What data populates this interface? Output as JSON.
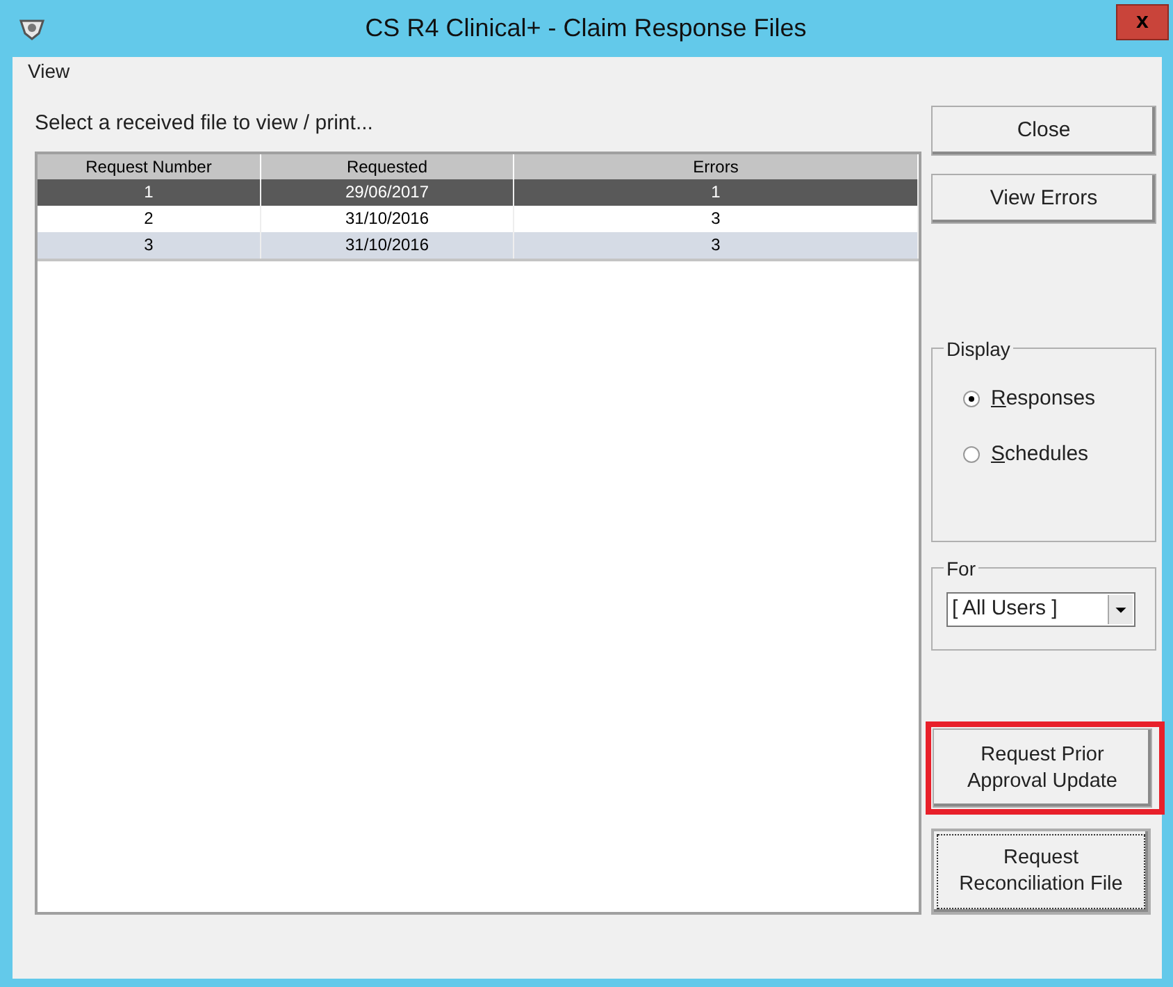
{
  "window": {
    "title": "CS R4 Clinical+ - Claim Response Files",
    "close": "x"
  },
  "menu": [
    "View"
  ],
  "instruction": "Select a received file to view / print...",
  "table": {
    "columns": [
      "Request Number",
      "Requested",
      "Errors"
    ],
    "rows": [
      {
        "cells": [
          "1",
          "29/06/2017",
          "1"
        ],
        "selected": true
      },
      {
        "cells": [
          "2",
          "31/10/2016",
          "3"
        ],
        "selected": false
      },
      {
        "cells": [
          "3",
          "31/10/2016",
          "3"
        ],
        "selected": false
      }
    ]
  },
  "buttons": [
    {
      "label": "Close"
    },
    {
      "label": "View Errors"
    }
  ],
  "display": {
    "title": "Display",
    "options": [
      {
        "label": "Responses",
        "selected": true
      },
      {
        "label": "Schedules",
        "selected": false
      }
    ]
  },
  "for": {
    "title": "For",
    "value": "[ All Users ]"
  },
  "bottom_buttons": [
    {
      "lines": [
        "Request Prior",
        "Approval Update"
      ],
      "highlighted": true,
      "focused": false
    },
    {
      "lines": [
        "Request",
        "Reconciliation File"
      ],
      "highlighted": false,
      "focused": true
    }
  ]
}
